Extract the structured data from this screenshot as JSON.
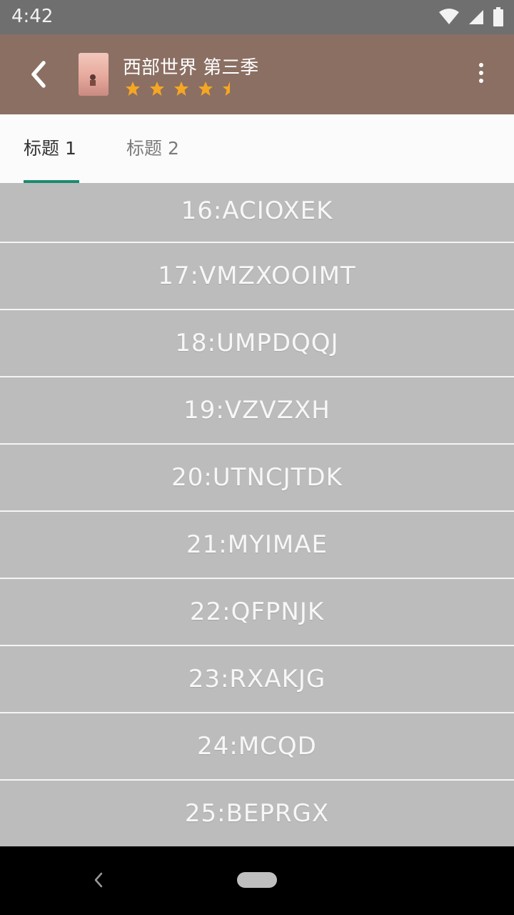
{
  "status_bar": {
    "time": "4:42",
    "icons": [
      "wifi-icon",
      "cell-signal-icon",
      "battery-icon"
    ]
  },
  "toolbar": {
    "title": "西部世界 第三季",
    "rating": 4.5,
    "rating_max": 5,
    "back_icon": "back-arrow-icon",
    "more_icon": "more-vertical-icon",
    "background": "#8b6f63"
  },
  "tabs": [
    {
      "label": "标题 1",
      "selected": true
    },
    {
      "label": "标题 2",
      "selected": false
    }
  ],
  "accent_color": "#1a8c6e",
  "list": {
    "items": [
      "16:ACIOXEK",
      "17:VMZXOOIMT",
      "18:UMPDQQJ",
      "19:VZVZXH",
      "20:UTNCJTDK",
      "21:MYIMAE",
      "22:QFPNJK",
      "23:RXAKJG",
      "24:MCQD",
      "25:BEPRGX"
    ]
  },
  "nav_bar": {
    "icons": [
      "nav-back-icon",
      "nav-home-pill"
    ]
  }
}
